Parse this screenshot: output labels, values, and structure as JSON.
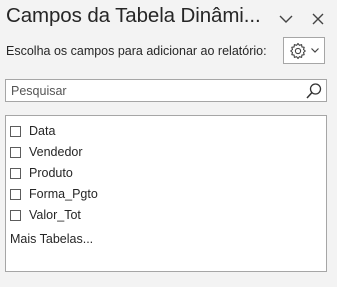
{
  "pane": {
    "title": "Campos da Tabela Dinâmi...",
    "subtitle": "Escolha os campos para adicionar ao relatório:",
    "icons": {
      "menu": "chevron-down-icon",
      "close": "close-icon",
      "settings": "gear-icon",
      "settings_dropdown": "chevron-down-icon",
      "search": "search-icon"
    }
  },
  "search": {
    "placeholder": "Pesquisar",
    "value": ""
  },
  "fields": [
    {
      "label": "Data",
      "checked": false
    },
    {
      "label": "Vendedor",
      "checked": false
    },
    {
      "label": "Produto",
      "checked": false
    },
    {
      "label": "Forma_Pgto",
      "checked": false
    },
    {
      "label": "Valor_Tot",
      "checked": false
    }
  ],
  "more_tables": "Mais Tabelas..."
}
